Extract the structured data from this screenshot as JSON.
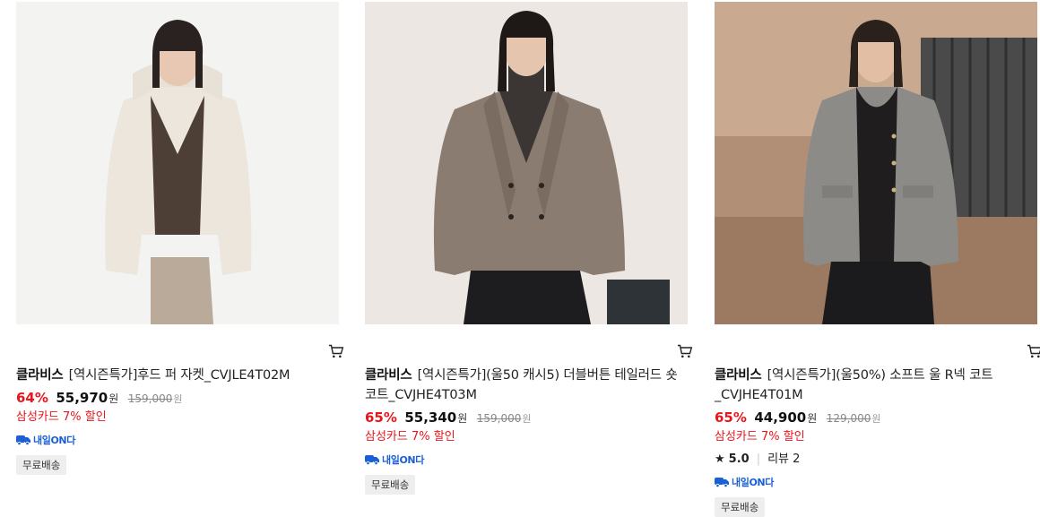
{
  "products": [
    {
      "brand": "클라비스",
      "name": "[역시즌특가]후드 퍼 자켓_CVJLE4T02M",
      "discount": "64%",
      "price": "55,970",
      "currency": "원",
      "original_price": "159,000",
      "original_currency": "원",
      "card_promo": "삼성카드 7% 할인",
      "delivery_badge": "내일ON다",
      "shipping": "무료배송",
      "image_icon": "product-photo-fur-hooded-jacket"
    },
    {
      "brand": "클라비스",
      "name": "[역시즌특가](울50 캐시5) 더블버튼 테일러드 숏 코트_CVJHE4T03M",
      "discount": "65%",
      "price": "55,340",
      "currency": "원",
      "original_price": "159,000",
      "original_currency": "원",
      "card_promo": "삼성카드 7% 할인",
      "delivery_badge": "내일ON다",
      "shipping": "무료배송",
      "image_icon": "product-photo-double-button-coat"
    },
    {
      "brand": "클라비스",
      "name": "[역시즌특가](울50%) 소프트 울 R넥 코트 _CVJHE4T01M",
      "discount": "65%",
      "price": "44,900",
      "currency": "원",
      "original_price": "129,000",
      "original_currency": "원",
      "card_promo": "삼성카드 7% 할인",
      "rating": "5.0",
      "review_label": "리뷰 2",
      "delivery_badge": "내일ON다",
      "shipping": "무료배송",
      "image_icon": "product-photo-round-neck-coat"
    }
  ],
  "colors": {
    "discount_red": "#e8161c",
    "delivery_blue": "#1a5fd6",
    "tag_bg": "#eeeeee"
  }
}
